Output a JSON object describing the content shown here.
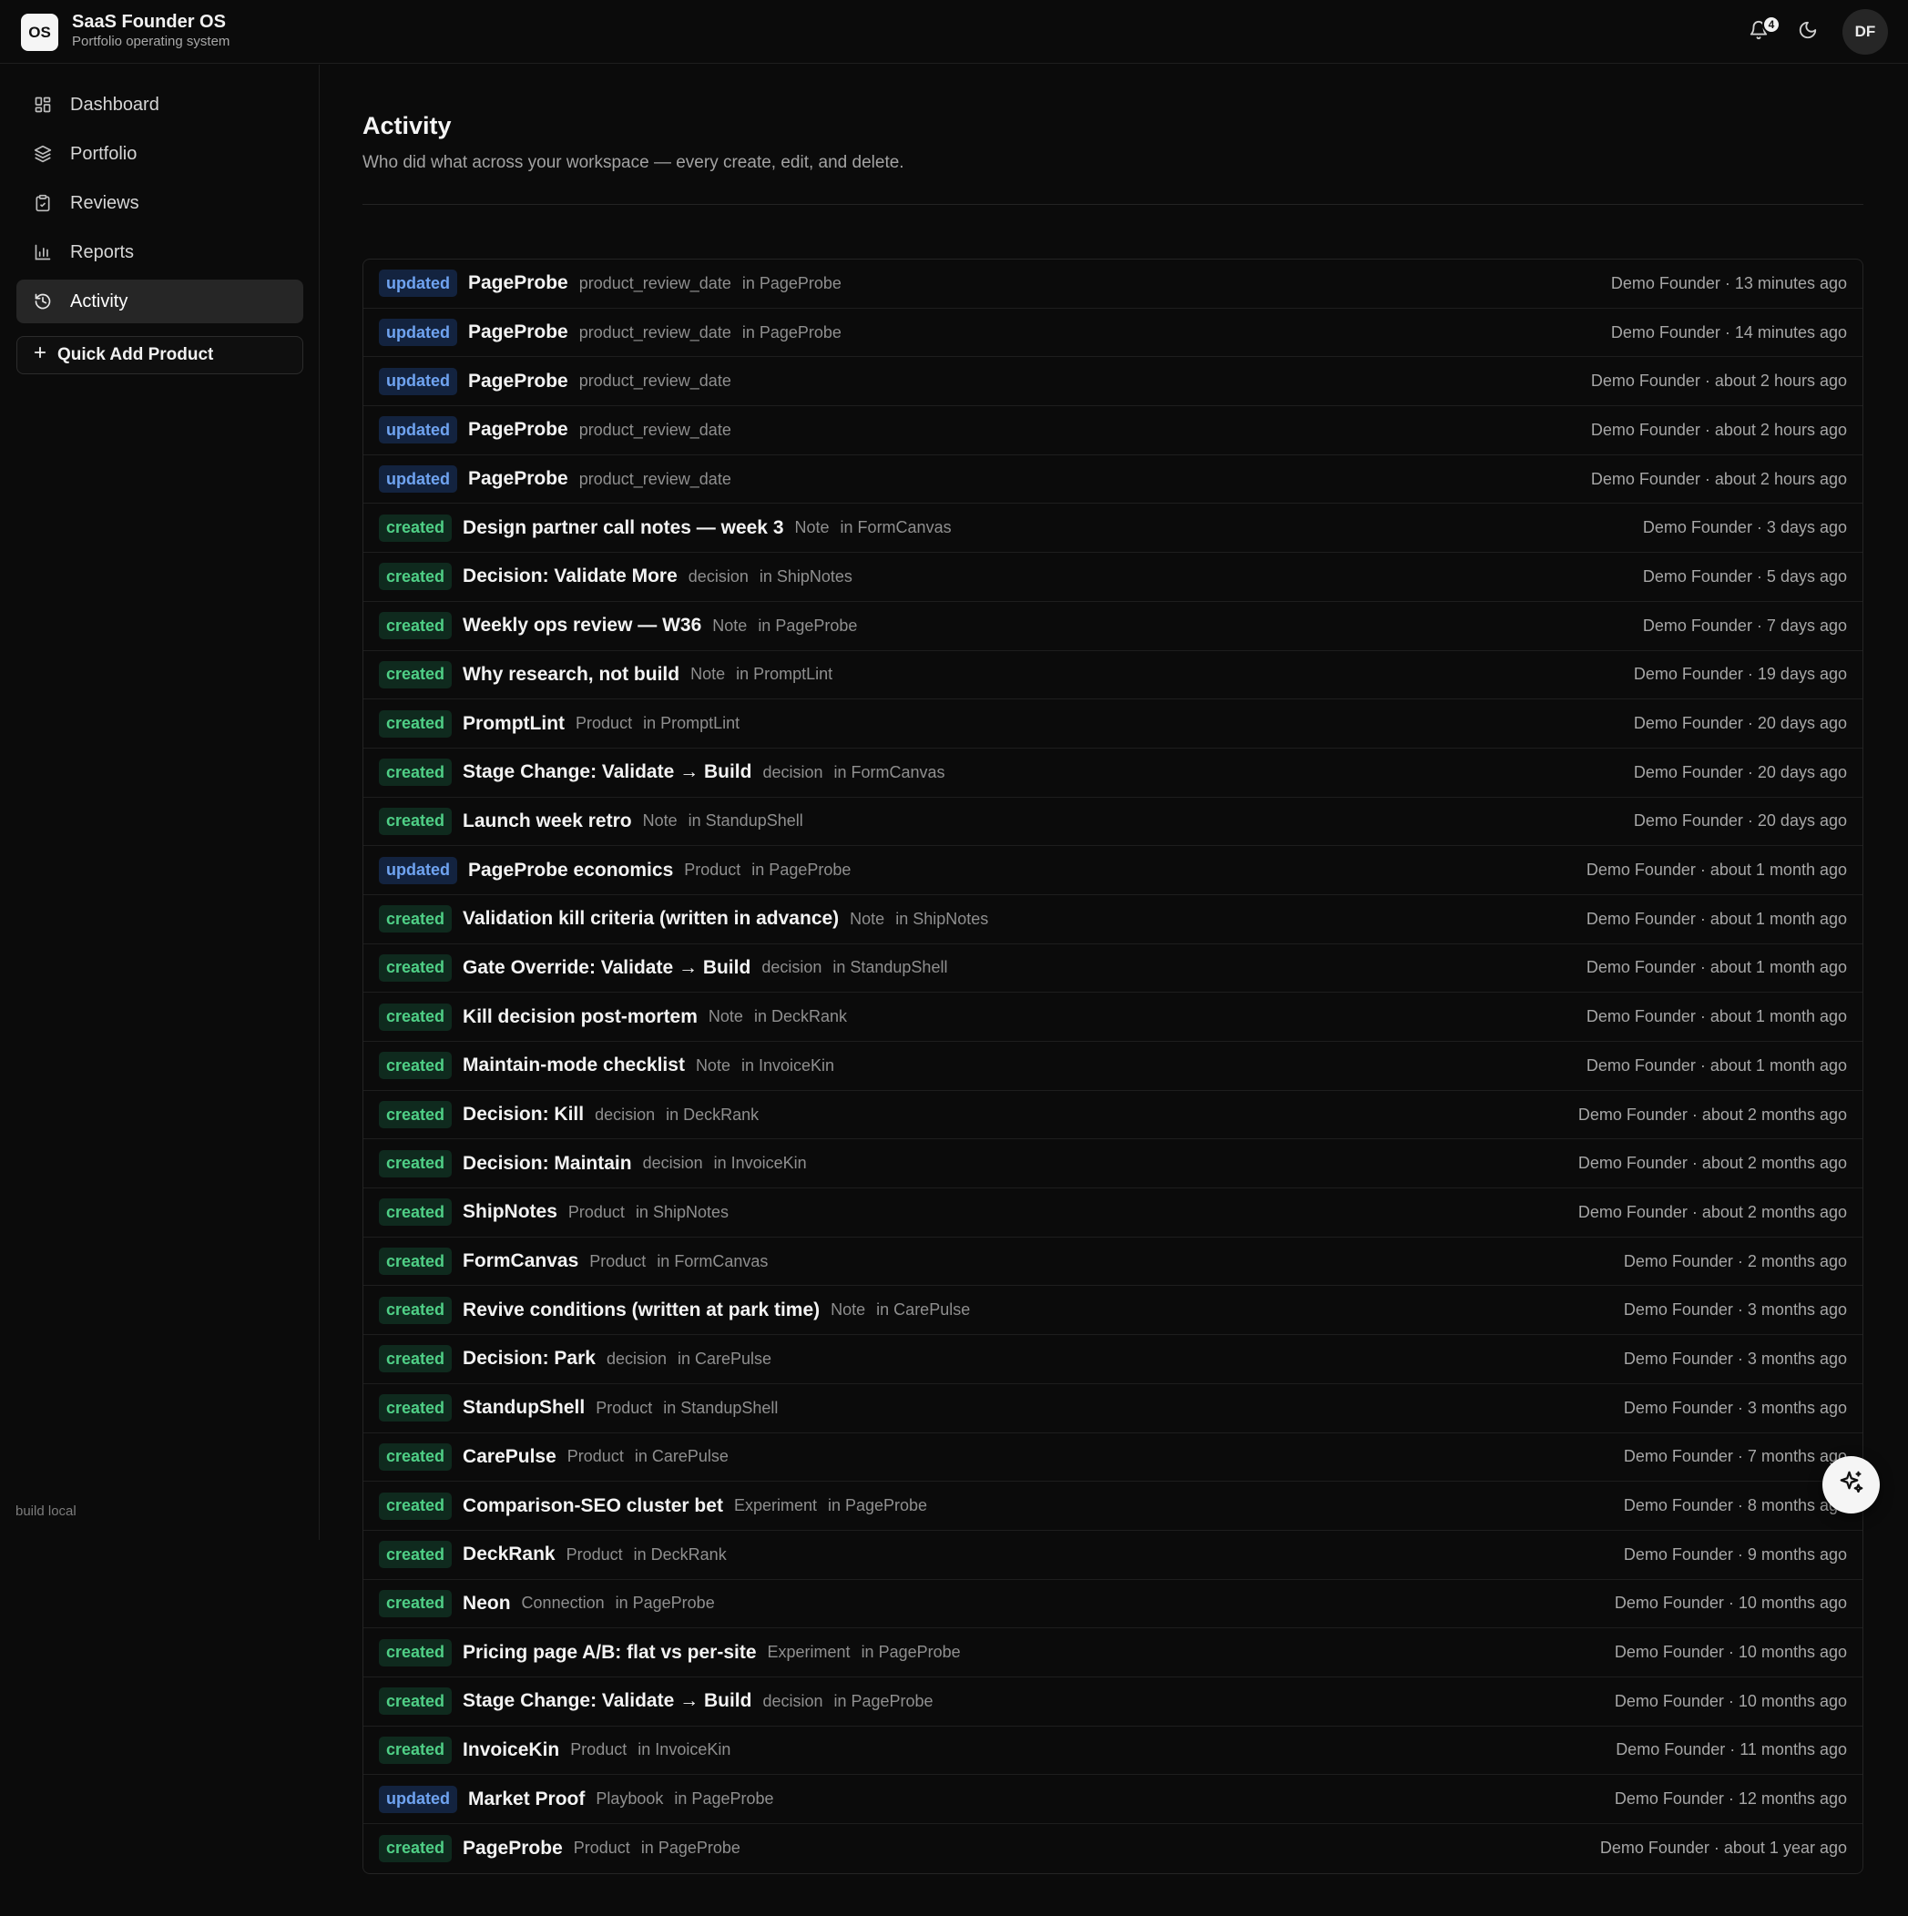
{
  "app": {
    "logo_text": "OS",
    "title": "SaaS Founder OS",
    "subtitle": "Portfolio operating system"
  },
  "header": {
    "notification_count": "4",
    "notification_icon": "bell-icon",
    "theme_icon": "moon-icon",
    "avatar_initials": "DF"
  },
  "sidebar": {
    "items": [
      {
        "label": "Dashboard",
        "icon": "dashboard-grid-icon",
        "active": false
      },
      {
        "label": "Portfolio",
        "icon": "layers-icon",
        "active": false
      },
      {
        "label": "Reviews",
        "icon": "clipboard-check-icon",
        "active": false
      },
      {
        "label": "Reports",
        "icon": "bar-chart-icon",
        "active": false
      },
      {
        "label": "Activity",
        "icon": "history-icon",
        "active": true
      }
    ],
    "quick_add_label": "Quick Add Product",
    "build_label": "build local"
  },
  "main": {
    "title": "Activity",
    "subtitle": "Who did what across your workspace — every create, edit, and delete."
  },
  "colors": {
    "updated_badge": "#6fa3f0",
    "created_badge": "#4fcf86",
    "background": "#0b0b0b"
  },
  "activity": [
    {
      "action": "updated",
      "title": "PageProbe",
      "type": "product_review_date",
      "scope": "in PageProbe",
      "meta": "Demo Founder · 13 minutes ago"
    },
    {
      "action": "updated",
      "title": "PageProbe",
      "type": "product_review_date",
      "scope": "in PageProbe",
      "meta": "Demo Founder · 14 minutes ago"
    },
    {
      "action": "updated",
      "title": "PageProbe",
      "type": "product_review_date",
      "scope": "",
      "meta": "Demo Founder · about 2 hours ago"
    },
    {
      "action": "updated",
      "title": "PageProbe",
      "type": "product_review_date",
      "scope": "",
      "meta": "Demo Founder · about 2 hours ago"
    },
    {
      "action": "updated",
      "title": "PageProbe",
      "type": "product_review_date",
      "scope": "",
      "meta": "Demo Founder · about 2 hours ago"
    },
    {
      "action": "created",
      "title": "Design partner call notes — week 3",
      "type": "Note",
      "scope": "in FormCanvas",
      "meta": "Demo Founder · 3 days ago"
    },
    {
      "action": "created",
      "title": "Decision: Validate More",
      "type": "decision",
      "scope": "in ShipNotes",
      "meta": "Demo Founder · 5 days ago"
    },
    {
      "action": "created",
      "title": "Weekly ops review — W36",
      "type": "Note",
      "scope": "in PageProbe",
      "meta": "Demo Founder · 7 days ago"
    },
    {
      "action": "created",
      "title": "Why research, not build",
      "type": "Note",
      "scope": "in PromptLint",
      "meta": "Demo Founder · 19 days ago"
    },
    {
      "action": "created",
      "title": "PromptLint",
      "type": "Product",
      "scope": "in PromptLint",
      "meta": "Demo Founder · 20 days ago"
    },
    {
      "action": "created",
      "title": "Stage Change: Validate → Build",
      "type": "decision",
      "scope": "in FormCanvas",
      "meta": "Demo Founder · 20 days ago"
    },
    {
      "action": "created",
      "title": "Launch week retro",
      "type": "Note",
      "scope": "in StandupShell",
      "meta": "Demo Founder · 20 days ago"
    },
    {
      "action": "updated",
      "title": "PageProbe economics",
      "type": "Product",
      "scope": "in PageProbe",
      "meta": "Demo Founder · about 1 month ago"
    },
    {
      "action": "created",
      "title": "Validation kill criteria (written in advance)",
      "type": "Note",
      "scope": "in ShipNotes",
      "meta": "Demo Founder · about 1 month ago"
    },
    {
      "action": "created",
      "title": "Gate Override: Validate → Build",
      "type": "decision",
      "scope": "in StandupShell",
      "meta": "Demo Founder · about 1 month ago"
    },
    {
      "action": "created",
      "title": "Kill decision post-mortem",
      "type": "Note",
      "scope": "in DeckRank",
      "meta": "Demo Founder · about 1 month ago"
    },
    {
      "action": "created",
      "title": "Maintain-mode checklist",
      "type": "Note",
      "scope": "in InvoiceKin",
      "meta": "Demo Founder · about 1 month ago"
    },
    {
      "action": "created",
      "title": "Decision: Kill",
      "type": "decision",
      "scope": "in DeckRank",
      "meta": "Demo Founder · about 2 months ago"
    },
    {
      "action": "created",
      "title": "Decision: Maintain",
      "type": "decision",
      "scope": "in InvoiceKin",
      "meta": "Demo Founder · about 2 months ago"
    },
    {
      "action": "created",
      "title": "ShipNotes",
      "type": "Product",
      "scope": "in ShipNotes",
      "meta": "Demo Founder · about 2 months ago"
    },
    {
      "action": "created",
      "title": "FormCanvas",
      "type": "Product",
      "scope": "in FormCanvas",
      "meta": "Demo Founder · 2 months ago"
    },
    {
      "action": "created",
      "title": "Revive conditions (written at park time)",
      "type": "Note",
      "scope": "in CarePulse",
      "meta": "Demo Founder · 3 months ago"
    },
    {
      "action": "created",
      "title": "Decision: Park",
      "type": "decision",
      "scope": "in CarePulse",
      "meta": "Demo Founder · 3 months ago"
    },
    {
      "action": "created",
      "title": "StandupShell",
      "type": "Product",
      "scope": "in StandupShell",
      "meta": "Demo Founder · 3 months ago"
    },
    {
      "action": "created",
      "title": "CarePulse",
      "type": "Product",
      "scope": "in CarePulse",
      "meta": "Demo Founder · 7 months ago"
    },
    {
      "action": "created",
      "title": "Comparison-SEO cluster bet",
      "type": "Experiment",
      "scope": "in PageProbe",
      "meta": "Demo Founder · 8 months ago"
    },
    {
      "action": "created",
      "title": "DeckRank",
      "type": "Product",
      "scope": "in DeckRank",
      "meta": "Demo Founder · 9 months ago"
    },
    {
      "action": "created",
      "title": "Neon",
      "type": "Connection",
      "scope": "in PageProbe",
      "meta": "Demo Founder · 10 months ago"
    },
    {
      "action": "created",
      "title": "Pricing page A/B: flat vs per-site",
      "type": "Experiment",
      "scope": "in PageProbe",
      "meta": "Demo Founder · 10 months ago"
    },
    {
      "action": "created",
      "title": "Stage Change: Validate → Build",
      "type": "decision",
      "scope": "in PageProbe",
      "meta": "Demo Founder · 10 months ago"
    },
    {
      "action": "created",
      "title": "InvoiceKin",
      "type": "Product",
      "scope": "in InvoiceKin",
      "meta": "Demo Founder · 11 months ago"
    },
    {
      "action": "updated",
      "title": "Market Proof",
      "type": "Playbook",
      "scope": "in PageProbe",
      "meta": "Demo Founder · 12 months ago"
    },
    {
      "action": "created",
      "title": "PagePr​obe",
      "type": "Product",
      "scope": "in PageProbe",
      "meta": "Demo Founder · about 1 year ago"
    }
  ],
  "fab_icon": "sparkles-icon"
}
